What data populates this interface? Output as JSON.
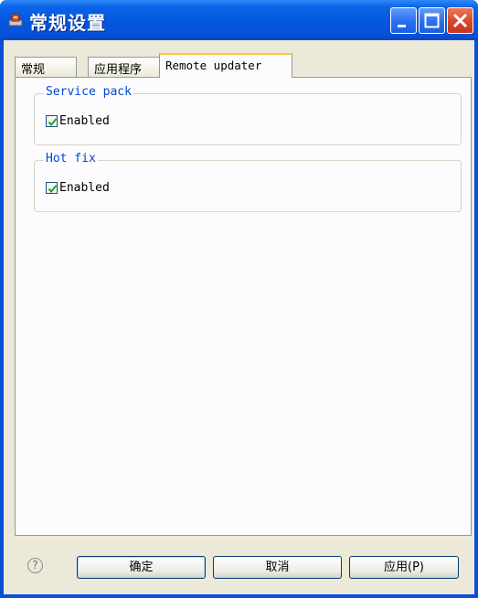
{
  "window": {
    "title": "常规设置",
    "controls": {
      "minimize": "minimize-icon",
      "maximize": "maximize-icon",
      "close": "close-icon"
    }
  },
  "tabs": [
    {
      "label": "常规",
      "active": false
    },
    {
      "label": "应用程序",
      "active": false
    },
    {
      "label": "Remote updater",
      "active": true
    }
  ],
  "groups": {
    "service_pack": {
      "legend": "Service pack",
      "checkbox_label": "Enabled",
      "checked": true
    },
    "hot_fix": {
      "legend": "Hot fix",
      "checkbox_label": "Enabled",
      "checked": true
    }
  },
  "footer": {
    "help": "?",
    "ok_label": "确定",
    "cancel_label": "取消",
    "apply_label": "应用(P)"
  },
  "colors": {
    "titlebar": "#0556df",
    "legend_text": "#0046d5",
    "checkmark": "#21a121",
    "close_button": "#d9452a"
  }
}
